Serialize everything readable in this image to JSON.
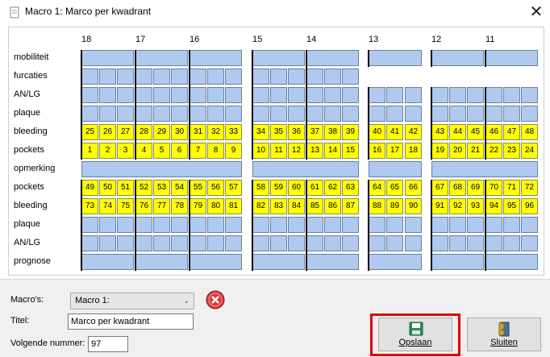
{
  "window": {
    "title": "Macro 1: Marco per kwadrant",
    "close_glyph": "✕"
  },
  "chart": {
    "quadrant_headers": [
      "18",
      "17",
      "16",
      "15",
      "14",
      "13",
      "12",
      "11"
    ],
    "row_labels": [
      "mobiliteit",
      "furcaties",
      "AN/LG",
      "plaque",
      "bleeding",
      "pockets",
      "opmerking",
      "pockets",
      "bleeding",
      "plaque",
      "AN/LG",
      "prognose"
    ],
    "upper_bleeding": [
      "25",
      "26",
      "27",
      "28",
      "29",
      "30",
      "31",
      "32",
      "33",
      "34",
      "35",
      "36",
      "37",
      "38",
      "39",
      "40",
      "41",
      "42",
      "43",
      "44",
      "45",
      "46",
      "47",
      "48"
    ],
    "upper_pockets": [
      "1",
      "2",
      "3",
      "4",
      "5",
      "6",
      "7",
      "8",
      "9",
      "10",
      "11",
      "12",
      "13",
      "14",
      "15",
      "16",
      "17",
      "18",
      "19",
      "20",
      "21",
      "22",
      "23",
      "24"
    ],
    "lower_pockets": [
      "49",
      "50",
      "51",
      "52",
      "53",
      "54",
      "55",
      "56",
      "57",
      "58",
      "59",
      "60",
      "61",
      "62",
      "63",
      "64",
      "65",
      "66",
      "67",
      "68",
      "69",
      "70",
      "71",
      "72"
    ],
    "lower_bleeding": [
      "73",
      "74",
      "75",
      "76",
      "77",
      "78",
      "79",
      "80",
      "81",
      "82",
      "83",
      "84",
      "85",
      "86",
      "87",
      "88",
      "89",
      "90",
      "91",
      "92",
      "93",
      "94",
      "95",
      "96"
    ],
    "colors": {
      "cell": "#b0c9ee",
      "highlight": "#ffff00",
      "group_border": "#000000"
    }
  },
  "form": {
    "macros_label": "Macro's:",
    "macros_value": "Macro 1:",
    "title_label": "Titel:",
    "title_value": "Marco per kwadrant",
    "next_number_label": "Volgende nummer:",
    "next_number_value": "97"
  },
  "buttons": {
    "save": "Opslaan",
    "close": "Sluiten"
  },
  "icons": {
    "window": "document-icon",
    "delete": "delete-icon",
    "save": "floppy-disk-icon",
    "exit": "exit-door-icon"
  }
}
